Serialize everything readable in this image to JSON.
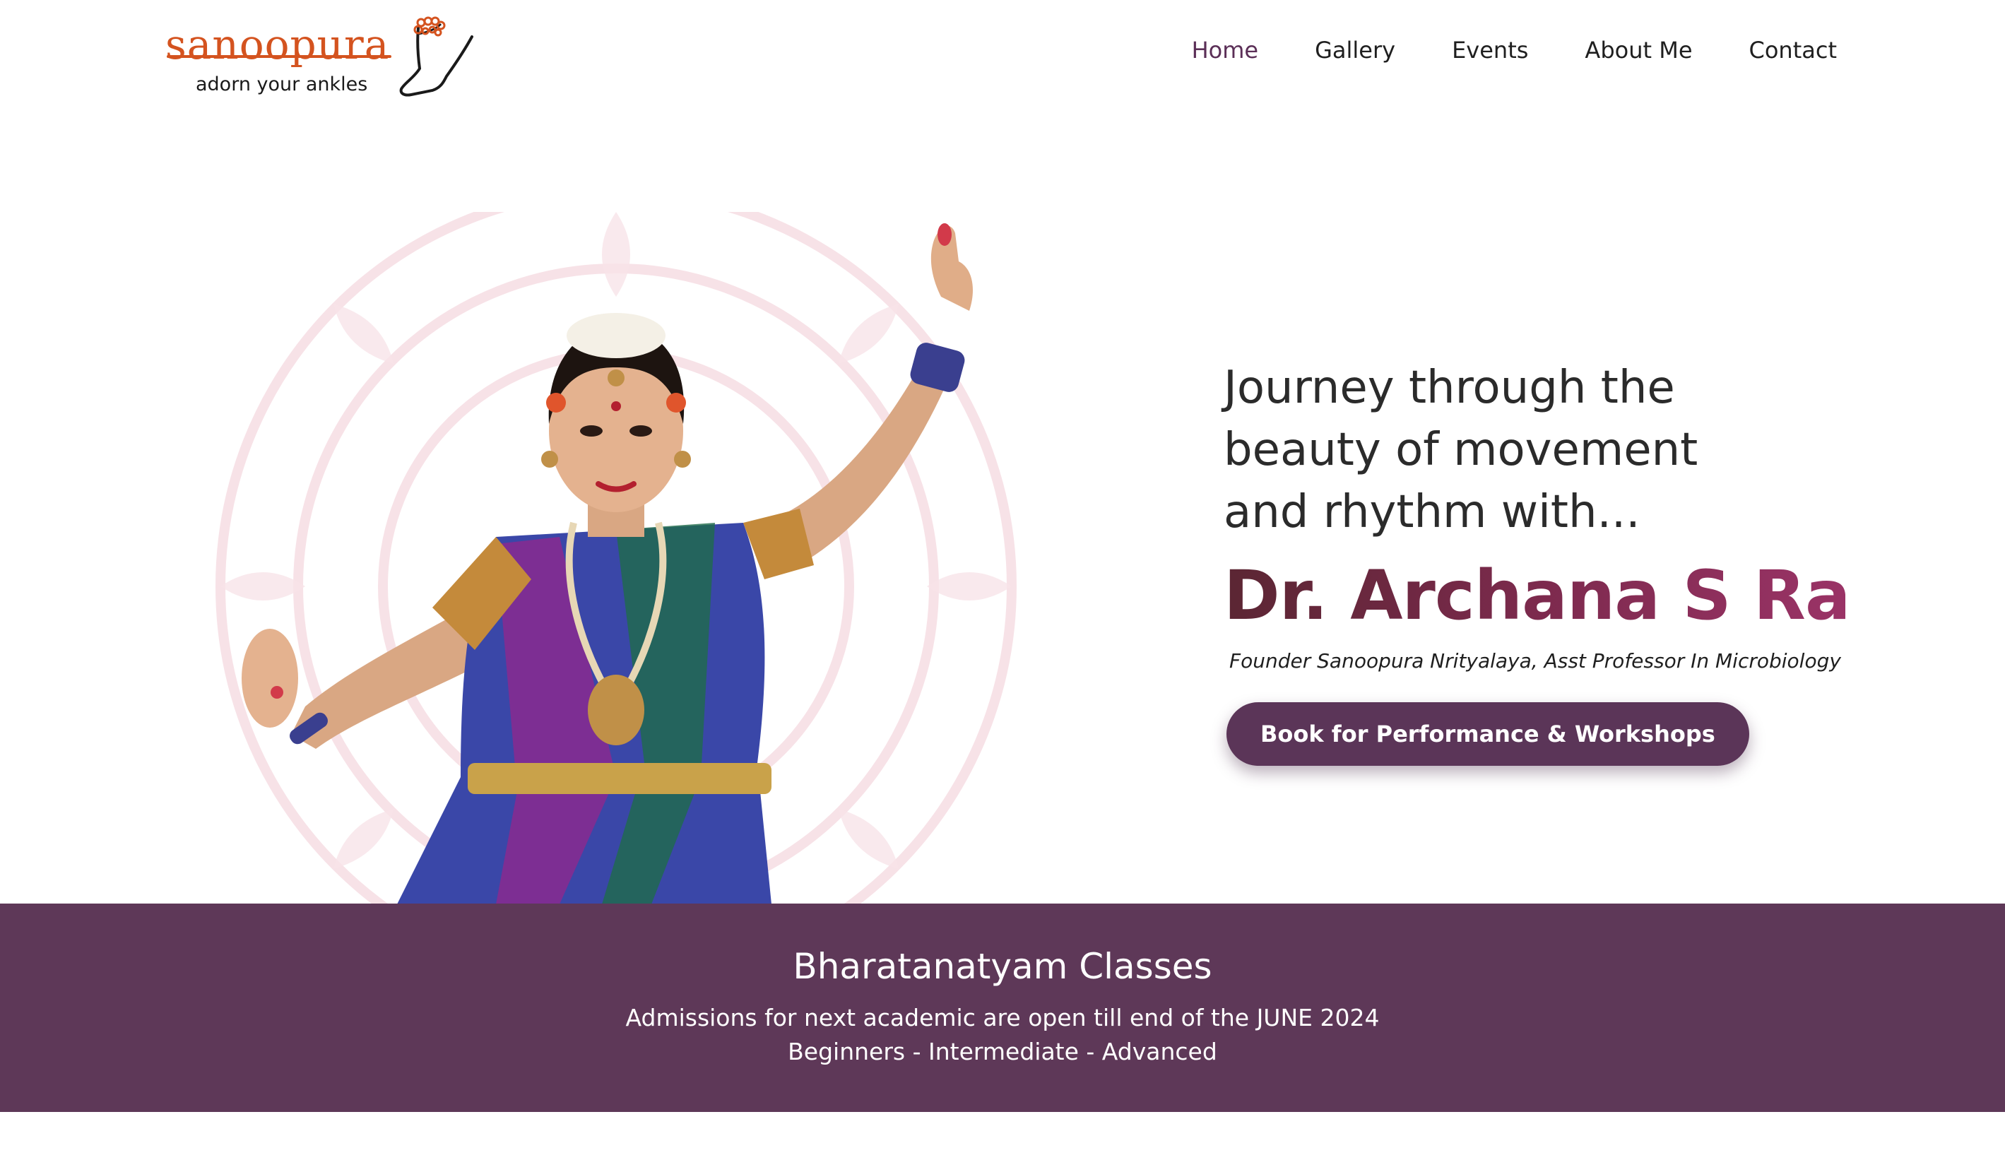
{
  "header": {
    "logo": {
      "brand": "sanoopura",
      "tagline": "adorn your ankles",
      "icon": "anklet-icon"
    },
    "nav": [
      {
        "label": "Home",
        "active": true
      },
      {
        "label": "Gallery",
        "active": false
      },
      {
        "label": "Events",
        "active": false
      },
      {
        "label": "About Me",
        "active": false
      },
      {
        "label": "Contact",
        "active": false
      }
    ]
  },
  "hero": {
    "tagline_lines": [
      "Journey through the",
      "beauty of movement",
      "and rhythm with..."
    ],
    "name": "Dr. Archana S Rao",
    "subtitle": "Founder Sanoopura Nrityalaya, Asst Professor In Microbiology",
    "cta_label": "Book for Performance & Workshops",
    "image": "bharatanatyam-dancer-photo"
  },
  "banner": {
    "title": "Bharatanatyam Classes",
    "line1": "Admissions for next academic are open till end of the JUNE 2024",
    "line2": "Beginners - Intermediate - Advanced"
  },
  "colors": {
    "accent": "#5b3558",
    "nav_active": "#5b2f57",
    "banner_bg": "#5e3858",
    "logo_orange": "#d4531f",
    "name_gradient_start": "#5b2633",
    "name_gradient_end": "#9a3366"
  }
}
